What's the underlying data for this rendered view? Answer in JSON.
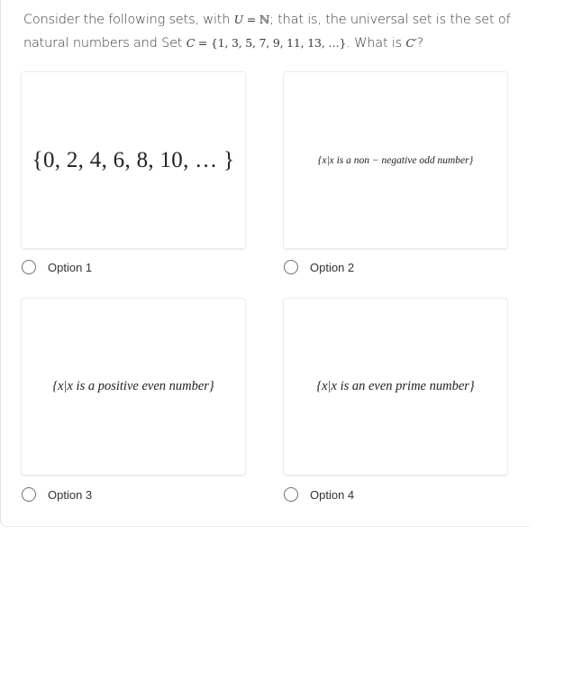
{
  "question": {
    "part1": "Consider the following sets, with ",
    "u_symbol": "U",
    "equals": " = ",
    "naturals_symbol": "ℕ",
    "part2": "; that is, the universal set is the set of natural numbers and Set ",
    "c_symbol": "C",
    "set_c": " = {1, 3, 5, 7, 9, 11, 13, …}",
    "part3": ".  What is ",
    "c_prime": "C′",
    "part4": "?"
  },
  "options": [
    {
      "card_text": "{0, 2, 4, 6, 8, 10, … }",
      "label": "Option 1",
      "selected": false
    },
    {
      "card_text": "{x|x is a non − negative odd number}",
      "label": "Option 2",
      "selected": false
    },
    {
      "card_text": "{x|x is a positive even number}",
      "label": "Option 3",
      "selected": false
    },
    {
      "card_text": "{x|x is an even prime number}",
      "label": "Option 4",
      "selected": false
    }
  ]
}
